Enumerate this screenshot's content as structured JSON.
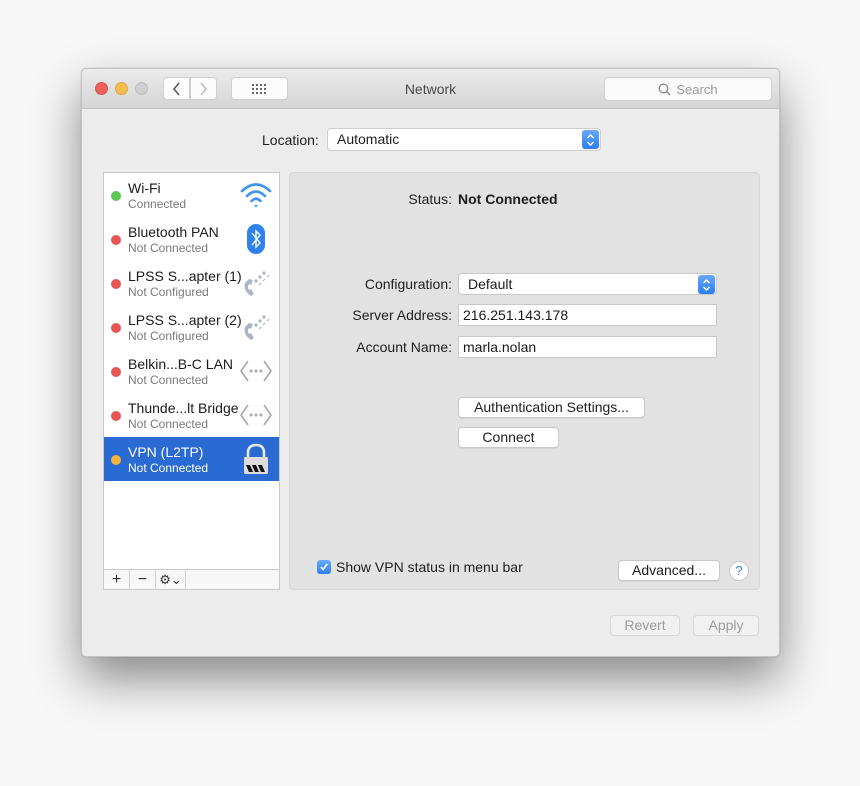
{
  "window": {
    "title": "Network",
    "search_placeholder": "Search",
    "controls": {
      "close_color": "#ed6158",
      "minimize_color": "#f4be4f",
      "zoom_color": "#d0d0d0"
    }
  },
  "location": {
    "label": "Location:",
    "value": "Automatic"
  },
  "services": [
    {
      "name": "Wi-Fi",
      "status": "Connected",
      "dot_color": "#5dc654",
      "icon": "wifi-icon",
      "selected": false
    },
    {
      "name": "Bluetooth PAN",
      "status": "Not Connected",
      "dot_color": "#e85550",
      "icon": "bluetooth-icon",
      "selected": false
    },
    {
      "name": "LPSS S...apter (1)",
      "status": "Not Configured",
      "dot_color": "#e85550",
      "icon": "phone-modem-icon",
      "selected": false
    },
    {
      "name": "LPSS S...apter (2)",
      "status": "Not Configured",
      "dot_color": "#e85550",
      "icon": "phone-modem-icon",
      "selected": false
    },
    {
      "name": "Belkin...B-C LAN",
      "status": "Not Connected",
      "dot_color": "#e85550",
      "icon": "ethernet-icon",
      "selected": false
    },
    {
      "name": "Thunde...lt Bridge",
      "status": "Not Connected",
      "dot_color": "#e85550",
      "icon": "ethernet-icon",
      "selected": false
    },
    {
      "name": "VPN (L2TP)",
      "status": "Not Connected",
      "dot_color": "#f5b33e",
      "icon": "lock-icon",
      "selected": true
    }
  ],
  "sidebar_toolbar": {
    "add": "+",
    "remove": "−",
    "action": "⚙⌄"
  },
  "detail": {
    "status_label": "Status:",
    "status_value": "Not Connected",
    "configuration_label": "Configuration:",
    "configuration_value": "Default",
    "server_label": "Server Address:",
    "server_value": "216.251.143.178",
    "account_label": "Account Name:",
    "account_value": "marla.nolan",
    "auth_button": "Authentication Settings...",
    "connect_button": "Connect",
    "show_status_label": "Show VPN status in menu bar",
    "show_status_checked": true,
    "advanced_button": "Advanced...",
    "help": "?"
  },
  "footer": {
    "revert": "Revert",
    "apply": "Apply"
  },
  "colors": {
    "accent": "#2a6bd3",
    "checkbox": "#2f7df2"
  }
}
